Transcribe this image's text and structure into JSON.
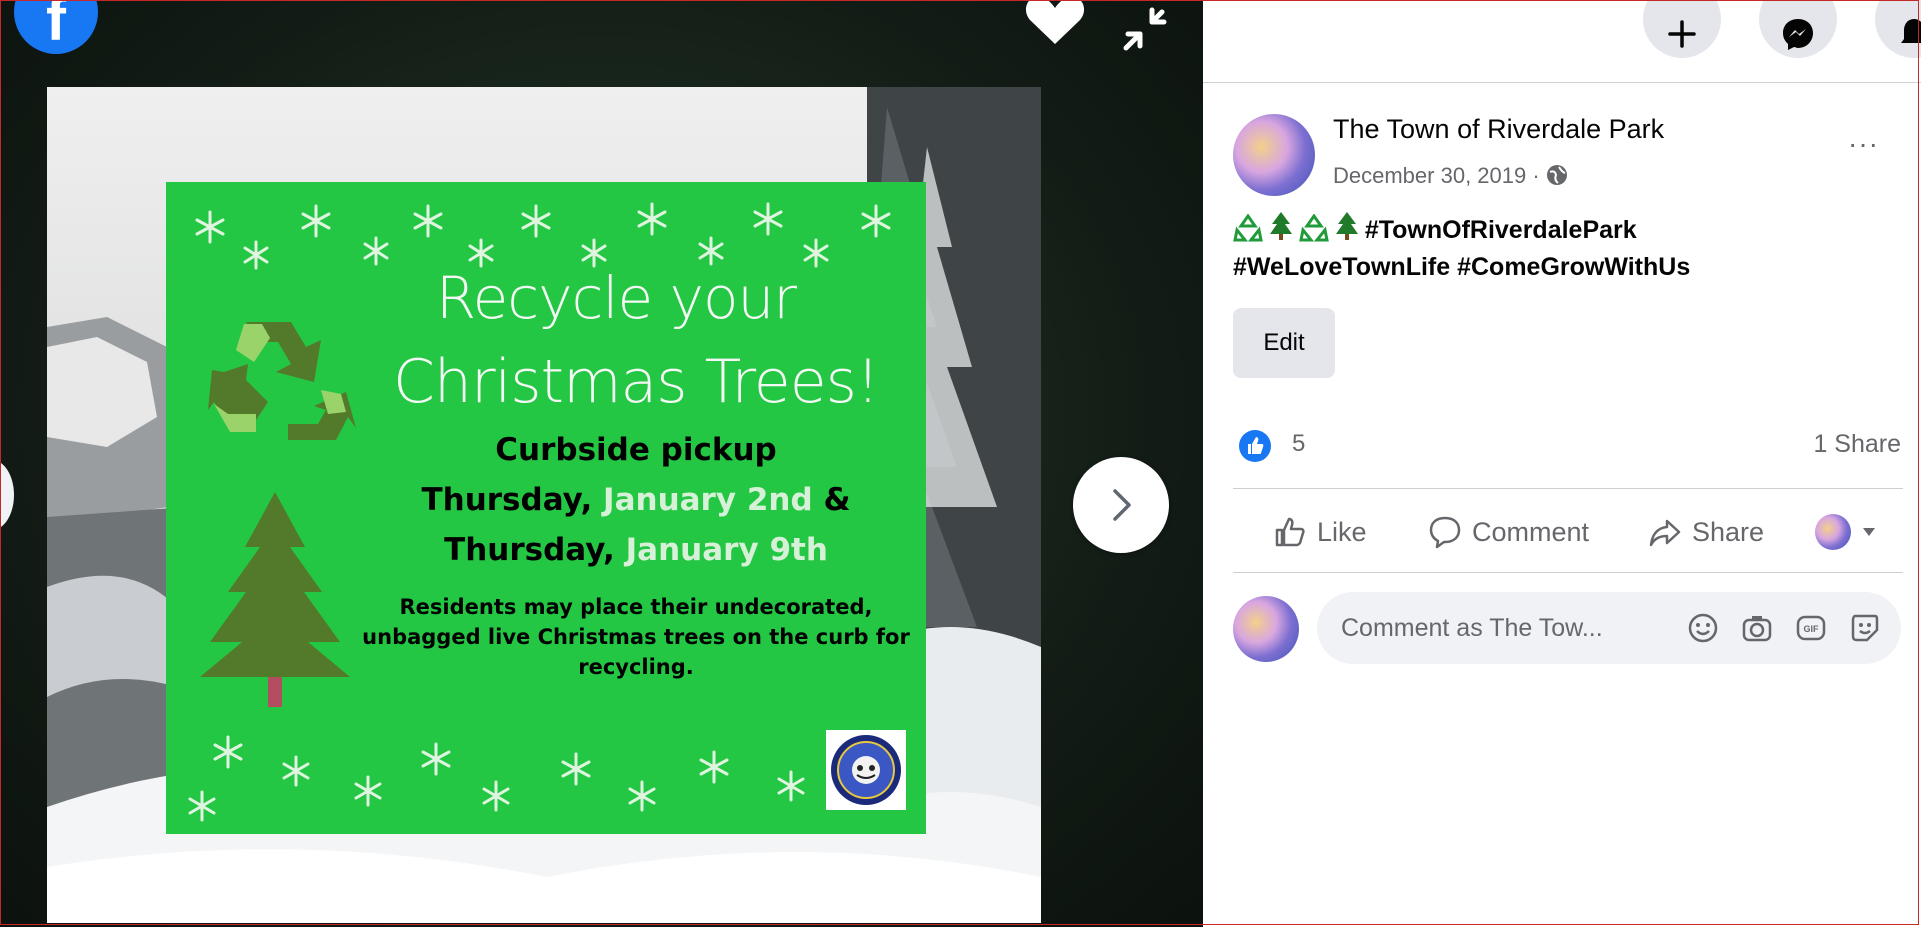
{
  "flyer": {
    "title_line1": "Recycle your",
    "title_line2": "Christmas Trees!",
    "curbside": "Curbside pickup",
    "line2_prefix": "Thursday, ",
    "line2_date": "January 2nd",
    "line2_suffix": " &",
    "line3_prefix": "Thursday, ",
    "line3_date": "January 9th",
    "residents": "Residents may place their undecorated, unbagged live Christmas trees on the curb for recycling."
  },
  "post": {
    "page_name": "The Town of Riverdale Park",
    "date": "December 30, 2019 ·",
    "more": "···",
    "text_line1": "#TownOfRiverdalePark",
    "text_line2": "#WeLoveTownLife #ComeGrowWithUs",
    "edit_label": "Edit",
    "like_count": "5",
    "share_count": "1 Share",
    "actions": {
      "like": "Like",
      "comment": "Comment",
      "share": "Share"
    },
    "comment_placeholder": "Comment as The Tow..."
  },
  "colors": {
    "flyer_green": "#24c744",
    "fb_blue": "#1877f2",
    "accent_text": "#d7f1d8"
  },
  "icons": [
    "facebook-logo-icon",
    "heart-icon",
    "collapse-icon",
    "next-chevron-icon",
    "plus-icon",
    "messenger-icon",
    "notifications-icon",
    "globe-icon",
    "like-thumb-icon",
    "comment-icon",
    "share-arrow-icon",
    "emoji-icon",
    "camera-icon",
    "gif-icon",
    "sticker-icon",
    "recycle-icon",
    "tree-icon",
    "seal-icon"
  ]
}
